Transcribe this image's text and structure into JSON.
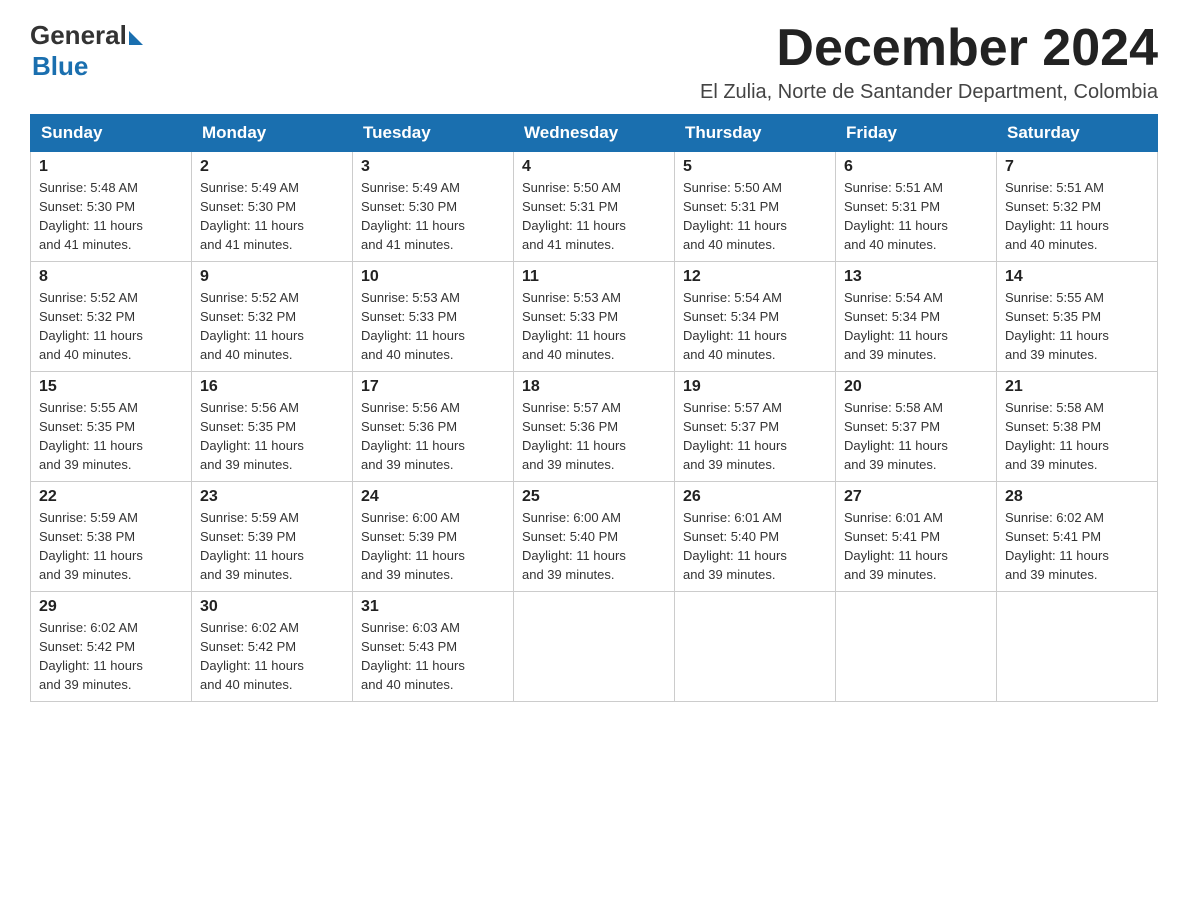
{
  "header": {
    "logo_general": "General",
    "logo_blue": "Blue",
    "month_title": "December 2024",
    "location": "El Zulia, Norte de Santander Department, Colombia"
  },
  "weekdays": [
    "Sunday",
    "Monday",
    "Tuesday",
    "Wednesday",
    "Thursday",
    "Friday",
    "Saturday"
  ],
  "weeks": [
    [
      {
        "day": "1",
        "sunrise": "5:48 AM",
        "sunset": "5:30 PM",
        "daylight": "11 hours and 41 minutes."
      },
      {
        "day": "2",
        "sunrise": "5:49 AM",
        "sunset": "5:30 PM",
        "daylight": "11 hours and 41 minutes."
      },
      {
        "day": "3",
        "sunrise": "5:49 AM",
        "sunset": "5:30 PM",
        "daylight": "11 hours and 41 minutes."
      },
      {
        "day": "4",
        "sunrise": "5:50 AM",
        "sunset": "5:31 PM",
        "daylight": "11 hours and 41 minutes."
      },
      {
        "day": "5",
        "sunrise": "5:50 AM",
        "sunset": "5:31 PM",
        "daylight": "11 hours and 40 minutes."
      },
      {
        "day": "6",
        "sunrise": "5:51 AM",
        "sunset": "5:31 PM",
        "daylight": "11 hours and 40 minutes."
      },
      {
        "day": "7",
        "sunrise": "5:51 AM",
        "sunset": "5:32 PM",
        "daylight": "11 hours and 40 minutes."
      }
    ],
    [
      {
        "day": "8",
        "sunrise": "5:52 AM",
        "sunset": "5:32 PM",
        "daylight": "11 hours and 40 minutes."
      },
      {
        "day": "9",
        "sunrise": "5:52 AM",
        "sunset": "5:32 PM",
        "daylight": "11 hours and 40 minutes."
      },
      {
        "day": "10",
        "sunrise": "5:53 AM",
        "sunset": "5:33 PM",
        "daylight": "11 hours and 40 minutes."
      },
      {
        "day": "11",
        "sunrise": "5:53 AM",
        "sunset": "5:33 PM",
        "daylight": "11 hours and 40 minutes."
      },
      {
        "day": "12",
        "sunrise": "5:54 AM",
        "sunset": "5:34 PM",
        "daylight": "11 hours and 40 minutes."
      },
      {
        "day": "13",
        "sunrise": "5:54 AM",
        "sunset": "5:34 PM",
        "daylight": "11 hours and 39 minutes."
      },
      {
        "day": "14",
        "sunrise": "5:55 AM",
        "sunset": "5:35 PM",
        "daylight": "11 hours and 39 minutes."
      }
    ],
    [
      {
        "day": "15",
        "sunrise": "5:55 AM",
        "sunset": "5:35 PM",
        "daylight": "11 hours and 39 minutes."
      },
      {
        "day": "16",
        "sunrise": "5:56 AM",
        "sunset": "5:35 PM",
        "daylight": "11 hours and 39 minutes."
      },
      {
        "day": "17",
        "sunrise": "5:56 AM",
        "sunset": "5:36 PM",
        "daylight": "11 hours and 39 minutes."
      },
      {
        "day": "18",
        "sunrise": "5:57 AM",
        "sunset": "5:36 PM",
        "daylight": "11 hours and 39 minutes."
      },
      {
        "day": "19",
        "sunrise": "5:57 AM",
        "sunset": "5:37 PM",
        "daylight": "11 hours and 39 minutes."
      },
      {
        "day": "20",
        "sunrise": "5:58 AM",
        "sunset": "5:37 PM",
        "daylight": "11 hours and 39 minutes."
      },
      {
        "day": "21",
        "sunrise": "5:58 AM",
        "sunset": "5:38 PM",
        "daylight": "11 hours and 39 minutes."
      }
    ],
    [
      {
        "day": "22",
        "sunrise": "5:59 AM",
        "sunset": "5:38 PM",
        "daylight": "11 hours and 39 minutes."
      },
      {
        "day": "23",
        "sunrise": "5:59 AM",
        "sunset": "5:39 PM",
        "daylight": "11 hours and 39 minutes."
      },
      {
        "day": "24",
        "sunrise": "6:00 AM",
        "sunset": "5:39 PM",
        "daylight": "11 hours and 39 minutes."
      },
      {
        "day": "25",
        "sunrise": "6:00 AM",
        "sunset": "5:40 PM",
        "daylight": "11 hours and 39 minutes."
      },
      {
        "day": "26",
        "sunrise": "6:01 AM",
        "sunset": "5:40 PM",
        "daylight": "11 hours and 39 minutes."
      },
      {
        "day": "27",
        "sunrise": "6:01 AM",
        "sunset": "5:41 PM",
        "daylight": "11 hours and 39 minutes."
      },
      {
        "day": "28",
        "sunrise": "6:02 AM",
        "sunset": "5:41 PM",
        "daylight": "11 hours and 39 minutes."
      }
    ],
    [
      {
        "day": "29",
        "sunrise": "6:02 AM",
        "sunset": "5:42 PM",
        "daylight": "11 hours and 39 minutes."
      },
      {
        "day": "30",
        "sunrise": "6:02 AM",
        "sunset": "5:42 PM",
        "daylight": "11 hours and 40 minutes."
      },
      {
        "day": "31",
        "sunrise": "6:03 AM",
        "sunset": "5:43 PM",
        "daylight": "11 hours and 40 minutes."
      },
      null,
      null,
      null,
      null
    ]
  ],
  "labels": {
    "sunrise": "Sunrise:",
    "sunset": "Sunset:",
    "daylight": "Daylight:"
  }
}
